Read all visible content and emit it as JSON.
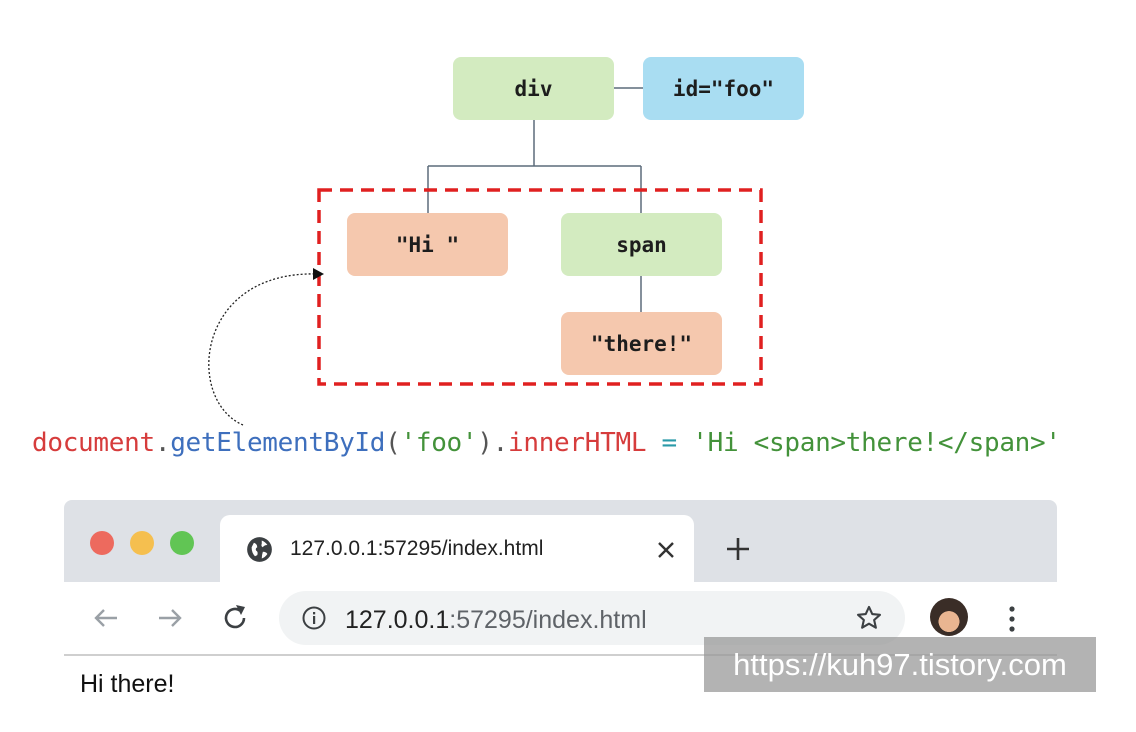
{
  "diagram": {
    "root": "div",
    "attribute": "id=\"foo\"",
    "children": [
      "\"Hi \"",
      "span"
    ],
    "grandchild": "\"there!\""
  },
  "code": {
    "document": "document",
    "dot1": ".",
    "method": "getElementById",
    "paren_open": "(",
    "arg": "'foo'",
    "paren_close": ")",
    "dot2": ".",
    "prop": "innerHTML",
    "eq": " = ",
    "value": "'Hi <span>there!</span>'"
  },
  "browser": {
    "tab_title": "127.0.0.1:57295/index.html",
    "url_host": "127.0.0.1",
    "url_rest": ":57295/index.html",
    "page_text": "Hi there!",
    "traffic_colors": [
      "#ed6a5e",
      "#f5bf4f",
      "#61c554"
    ],
    "icons": [
      "globe-icon",
      "close-icon",
      "plus-icon",
      "back-arrow-icon",
      "forward-arrow-icon",
      "reload-icon",
      "info-icon",
      "star-icon",
      "menu-dots-icon"
    ]
  },
  "watermark": "https://kuh97.tistory.com"
}
